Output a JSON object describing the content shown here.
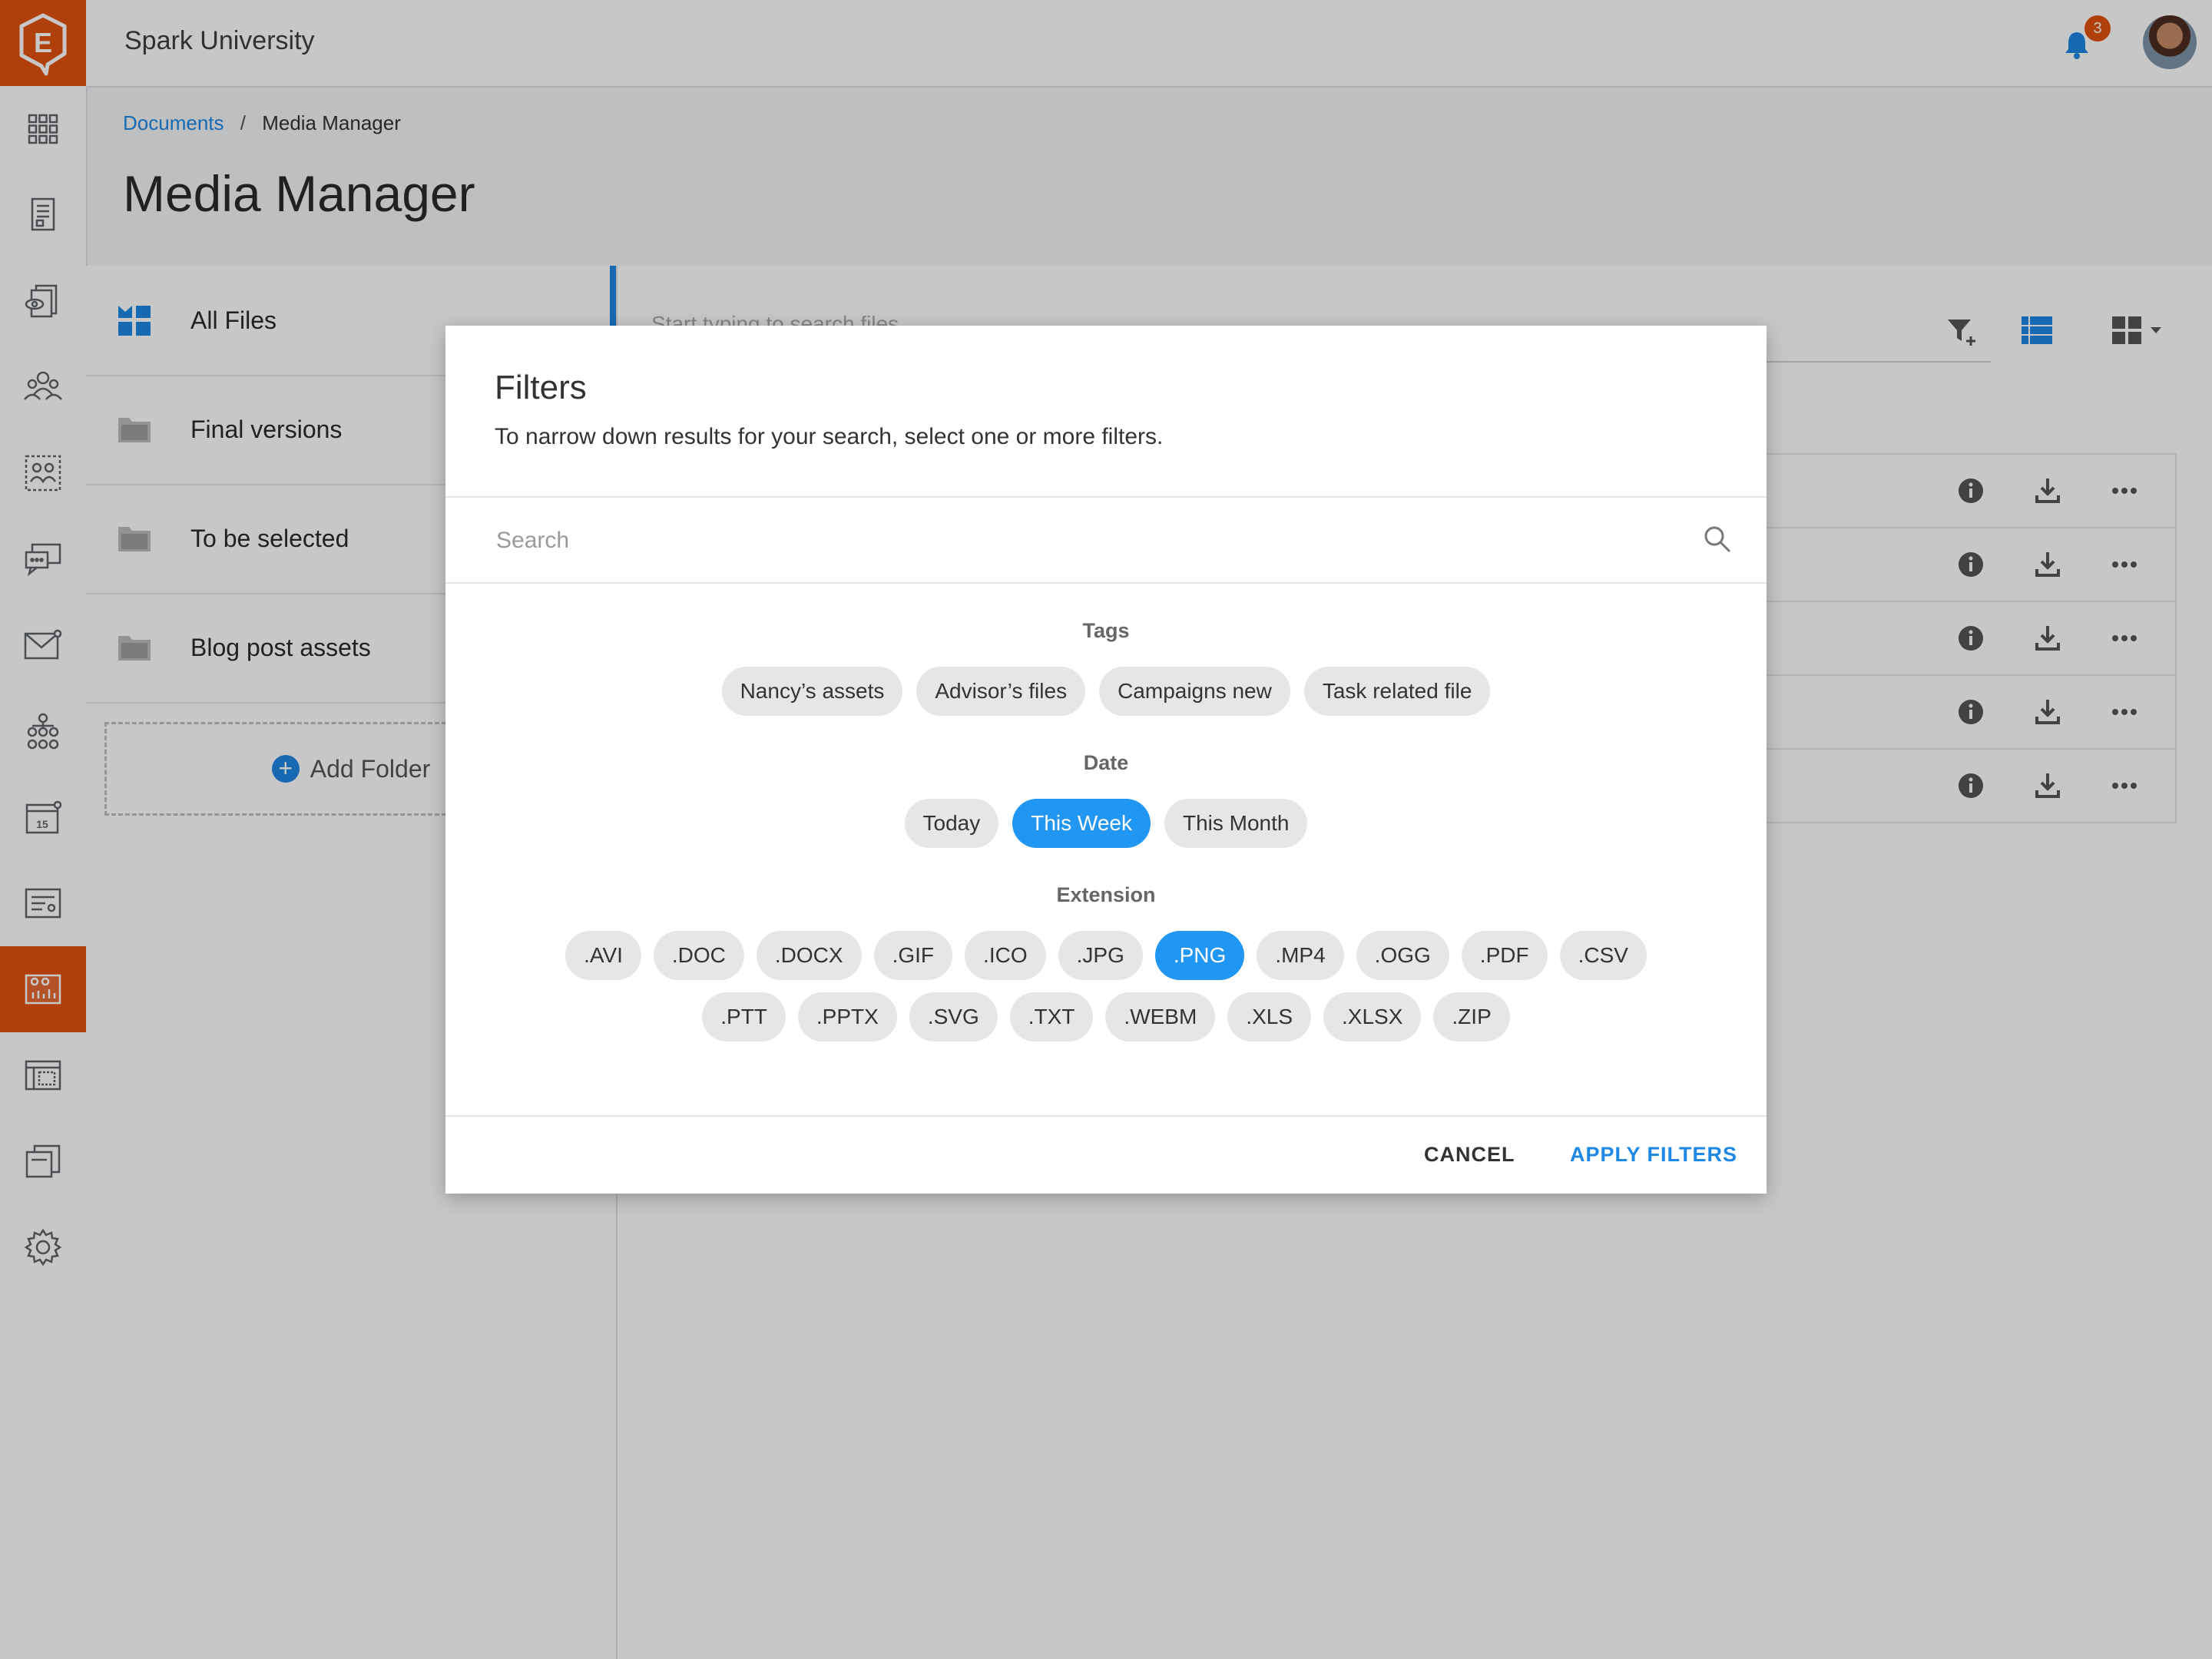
{
  "app": {
    "name": "Spark University",
    "notifications": "3",
    "logo_letter": "E"
  },
  "sidebar": {
    "items": [
      "dashboard-grid-icon",
      "document-list-icon",
      "document-review-icon",
      "people-group-icon",
      "team-directory-icon",
      "chat-bubbles-icon",
      "mail-icon",
      "org-chart-icon",
      "calendar-icon",
      "forms-icon",
      "media-manager-icon",
      "table-sheet-icon",
      "documents-stack-icon",
      "gear-icon"
    ],
    "active_index": 10
  },
  "breadcrumb": {
    "parent": "Documents",
    "separator": "/",
    "current": "Media Manager"
  },
  "page": {
    "title": "Media Manager"
  },
  "folders": {
    "items": [
      {
        "label": "All Files"
      },
      {
        "label": "Final versions"
      },
      {
        "label": "To be selected"
      },
      {
        "label": "Blog post assets"
      }
    ],
    "add_label": "Add Folder"
  },
  "files": {
    "search_placeholder": "Start typing to search files"
  },
  "modal": {
    "title": "Filters",
    "subtitle": "To narrow down results for your search, select one or more filters.",
    "search_placeholder": "Search",
    "tags_label": "Tags",
    "tags": [
      "Nancy’s assets",
      "Advisor’s files",
      "Campaigns new",
      "Task related file"
    ],
    "date_label": "Date",
    "dates": [
      "Today",
      "This Week",
      "This Month"
    ],
    "date_selected": "This Week",
    "extension_label": "Extension",
    "extensions_row1": [
      ".AVI",
      ".DOC",
      ".DOCX",
      ".GIF",
      ".ICO",
      ".JPG",
      ".PNG",
      ".MP4",
      ".OGG",
      ".PDF",
      ".CSV"
    ],
    "extensions_row2": [
      ".PTT",
      ".PPTX",
      ".SVG",
      ".TXT",
      ".WEBM",
      ".XLS",
      ".XLSX",
      ".ZIP"
    ],
    "extension_selected": ".PNG",
    "cancel_label": "CANCEL",
    "apply_label": "APPLY FILTERS"
  },
  "colors": {
    "brand": "#e2510f",
    "accent": "#1e88e5",
    "chip_selected": "#2196f3"
  }
}
